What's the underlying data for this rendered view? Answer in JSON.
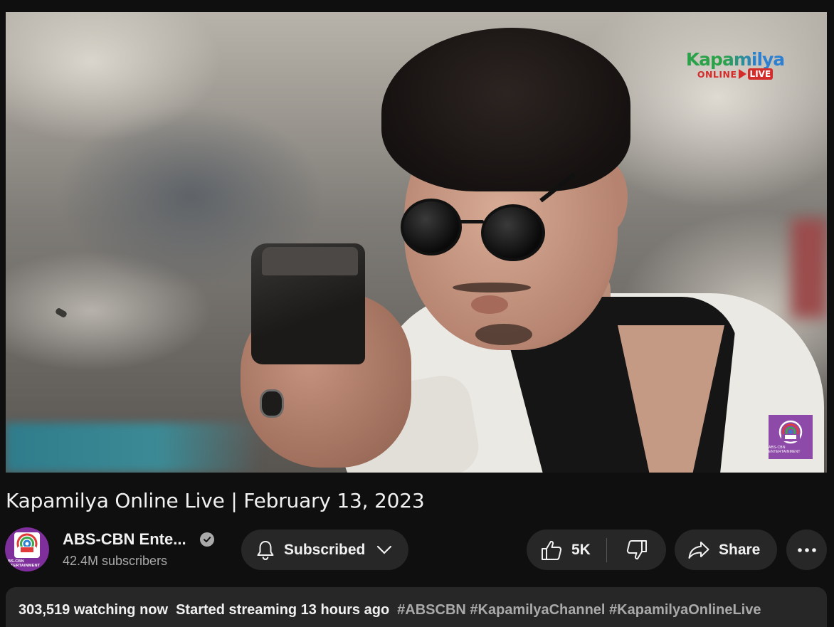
{
  "video": {
    "title": "Kapamilya Online Live | February 13, 2023",
    "overlay_logo": {
      "word": "Kapamilya",
      "sub": "ONLINE",
      "live": "LIVE"
    },
    "corner_badge": "ABS-CBN ENTERTAINMENT"
  },
  "channel": {
    "name": "ABS-CBN Ente...",
    "subscribers": "42.4M subscribers",
    "avatar_caption": "ABS-CBN ENTERTAINMENT",
    "verified_icon": "check-circle-icon"
  },
  "actions": {
    "subscribe_label": "Subscribed",
    "like_count": "5K",
    "share_label": "Share"
  },
  "description": {
    "watching": "303,519 watching now",
    "started": "Started streaming 13 hours ago",
    "hashtags": [
      "#ABSCBN",
      "#KapamilyaChannel",
      "#KapamilyaOnlineLive"
    ]
  },
  "colors": {
    "background": "#0f0f0f",
    "pill": "#272727",
    "secondary_text": "#aaaaaa",
    "brand_purple": "#8e4aa8",
    "live_red": "#d42b2b"
  }
}
